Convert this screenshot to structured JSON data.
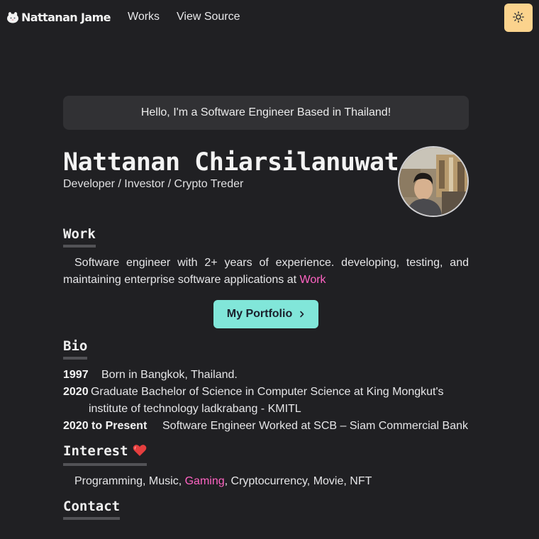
{
  "nav": {
    "logo_text": "Nattanan Jame",
    "links": [
      {
        "label": "Works"
      },
      {
        "label": "View Source"
      }
    ],
    "theme_toggle_icon": "sun-icon",
    "theme_toggle_color": "#fbd38d"
  },
  "hero": {
    "greeting": "Hello, I'm a Software Engineer Based in Thailand!",
    "name": "Nattanan Chiarsilanuwat",
    "role": "Developer / Investor / Crypto Treder"
  },
  "work": {
    "title": "Work",
    "text_before": "Software engineer with 2+ years of experience. developing, testing, and maintaining enterprise software applications at ",
    "link_label": "Work",
    "button_label": "My Portfolio",
    "button_icon": "chevron-right-icon",
    "button_color": "#81e6d9"
  },
  "bio": {
    "title": "Bio",
    "items": [
      {
        "year": "1997",
        "text": "Born in Bangkok, Thailand."
      },
      {
        "year": "2020",
        "text": "Graduate Bachelor of Science in Computer Science at King Mongkut's institute of technology ladkrabang - KMITL"
      },
      {
        "year": "2020 to Present",
        "text": "Software Engineer Worked at SCB – Siam Commercial Bank"
      }
    ]
  },
  "interest": {
    "title": "Interest",
    "icon": "heart-icon",
    "before": "Programming, Music, ",
    "link": "Gaming",
    "after": ", Cryptocurrency, Movie, NFT"
  },
  "contact": {
    "title": "Contact"
  },
  "colors": {
    "background": "#202023",
    "link_pink": "#ff63c3",
    "card_bg": "#313134"
  }
}
